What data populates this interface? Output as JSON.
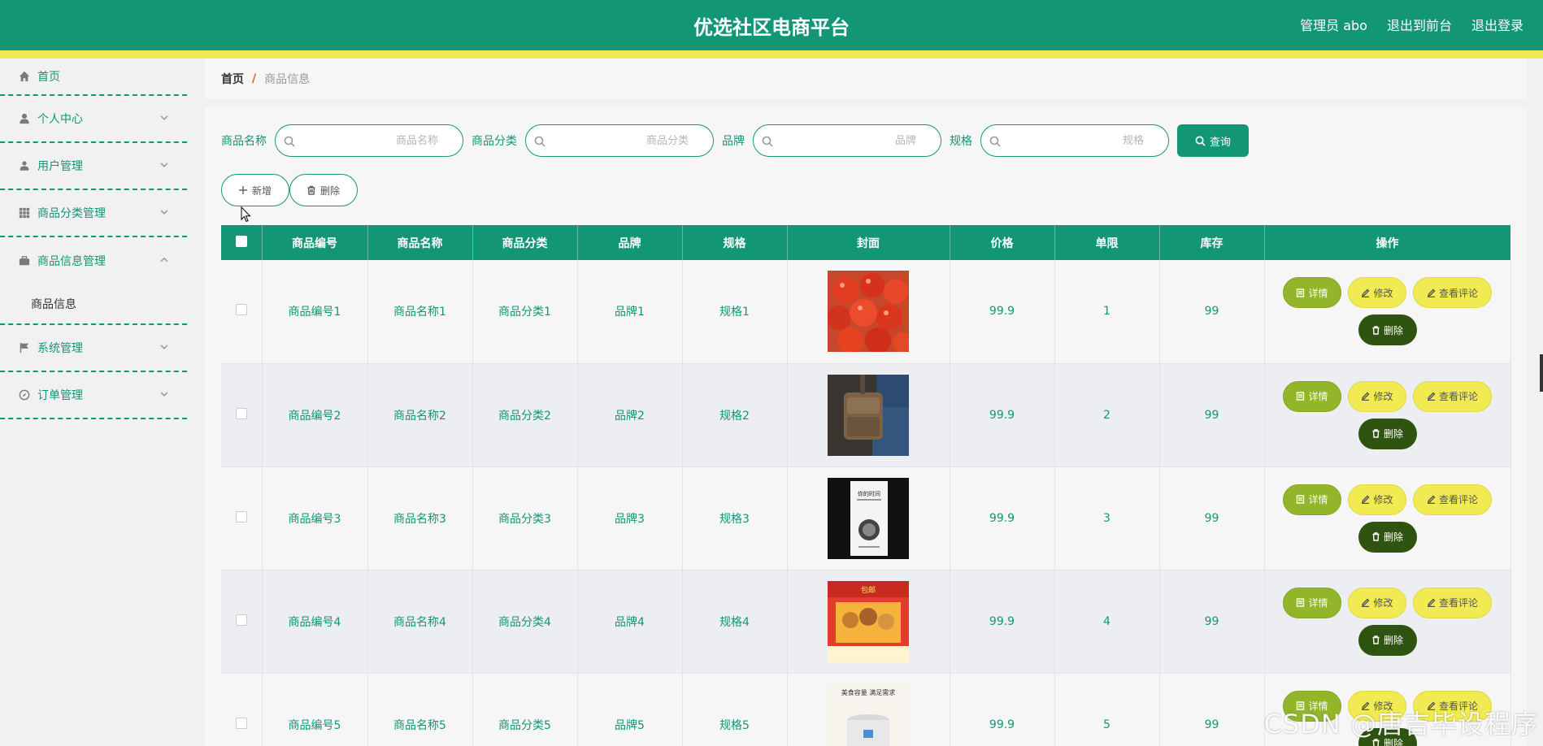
{
  "header": {
    "title": "优选社区电商平台",
    "admin": "管理员 abo",
    "to_front": "退出到前台",
    "logout": "退出登录"
  },
  "sidebar": {
    "items": [
      {
        "label": "首页",
        "icon": "home-icon"
      },
      {
        "label": "个人中心",
        "icon": "user-icon"
      },
      {
        "label": "用户管理",
        "icon": "user-manage-icon"
      },
      {
        "label": "商品分类管理",
        "icon": "grid-icon"
      },
      {
        "label": "商品信息管理",
        "icon": "briefcase-icon",
        "expanded": true,
        "sub": "商品信息"
      },
      {
        "label": "系统管理",
        "icon": "flag-icon"
      },
      {
        "label": "订单管理",
        "icon": "compass-icon"
      }
    ]
  },
  "breadcrumb": {
    "home": "首页",
    "sep": "/",
    "current": "商品信息"
  },
  "search": {
    "name_label": "商品名称",
    "name_placeholder": "商品名称",
    "category_label": "商品分类",
    "category_placeholder": "商品分类",
    "brand_label": "品牌",
    "brand_placeholder": "品牌",
    "spec_label": "规格",
    "spec_placeholder": "规格",
    "query": "查询"
  },
  "actions": {
    "add": "新增",
    "delete": "删除"
  },
  "table": {
    "headers": [
      "商品编号",
      "商品名称",
      "商品分类",
      "品牌",
      "规格",
      "封面",
      "价格",
      "单限",
      "库存",
      "操作"
    ],
    "rows": [
      {
        "code": "商品编号1",
        "name": "商品名称1",
        "category": "商品分类1",
        "brand": "品牌1",
        "spec": "规格1",
        "price": "99.9",
        "limit": "1",
        "stock": "99",
        "cover": "cherries"
      },
      {
        "code": "商品编号2",
        "name": "商品名称2",
        "category": "商品分类2",
        "brand": "品牌2",
        "spec": "规格2",
        "price": "99.9",
        "limit": "2",
        "stock": "99",
        "cover": "bag"
      },
      {
        "code": "商品编号3",
        "name": "商品名称3",
        "category": "商品分类3",
        "brand": "品牌3",
        "spec": "规格3",
        "price": "99.9",
        "limit": "3",
        "stock": "99",
        "cover": "book",
        "cover_text": "你的时间"
      },
      {
        "code": "商品编号4",
        "name": "商品名称4",
        "category": "商品分类4",
        "brand": "品牌4",
        "spec": "规格4",
        "price": "99.9",
        "limit": "4",
        "stock": "99",
        "cover": "gift-box",
        "cover_text": "包邮"
      },
      {
        "code": "商品编号5",
        "name": "商品名称5",
        "category": "商品分类5",
        "brand": "品牌5",
        "spec": "规格5",
        "price": "99.9",
        "limit": "5",
        "stock": "99",
        "cover": "cooker",
        "cover_text": "美食容量 满足需求"
      }
    ],
    "ops": {
      "detail": "详情",
      "edit": "修改",
      "review": "查看评论",
      "delete": "删除"
    }
  },
  "watermark": "CSDN @唐吉毕设程序",
  "colors": {
    "primary": "#129675",
    "stripe": "#f2ea52",
    "detail": "#93b52a",
    "delete": "#2f5310"
  }
}
